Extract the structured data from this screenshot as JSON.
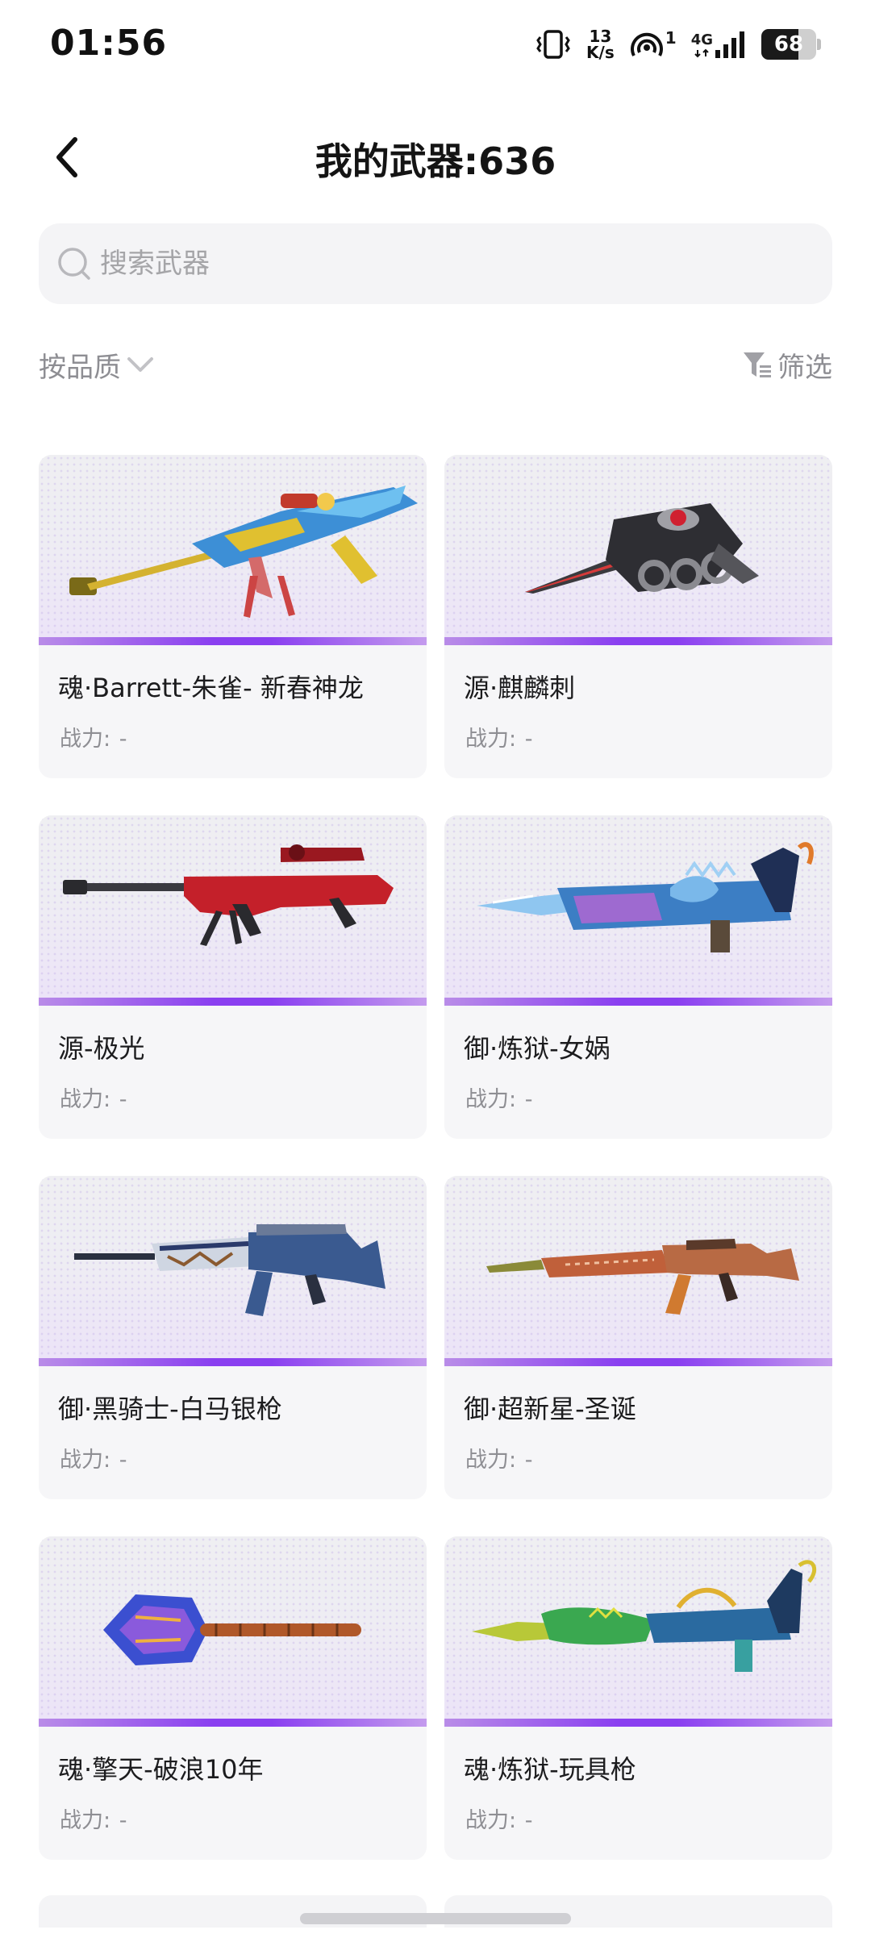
{
  "status_bar": {
    "time": "01:56",
    "net_speed_value": "13",
    "net_speed_unit": "K/s",
    "network": "4G",
    "hotspot_count": "1",
    "battery_level": "68",
    "battery_fraction": 0.68
  },
  "header": {
    "title": "我的武器:636"
  },
  "search": {
    "placeholder": "搜索武器"
  },
  "toolbar": {
    "sort_label": "按品质",
    "filter_label": "筛选"
  },
  "weapons": [
    {
      "name": "魂·Barrett-朱雀- 新春神龙",
      "power_label": "战力:",
      "power_value": "-"
    },
    {
      "name": "源·麒麟刺",
      "power_label": "战力:",
      "power_value": "-"
    },
    {
      "name": "源-极光",
      "power_label": "战力:",
      "power_value": "-"
    },
    {
      "name": "御·炼狱-女娲",
      "power_label": "战力:",
      "power_value": "-"
    },
    {
      "name": "御·黑骑士-白马银枪",
      "power_label": "战力:",
      "power_value": "-"
    },
    {
      "name": "御·超新星-圣诞",
      "power_label": "战力:",
      "power_value": "-"
    },
    {
      "name": "魂·擎天-破浪10年",
      "power_label": "战力:",
      "power_value": "-"
    },
    {
      "name": "魂·炼狱-玩具枪",
      "power_label": "战力:",
      "power_value": "-"
    }
  ],
  "colors": {
    "accent_purple": "#8a3ff0",
    "text_secondary": "#8e8e93",
    "card_background": "#f6f6f8"
  }
}
